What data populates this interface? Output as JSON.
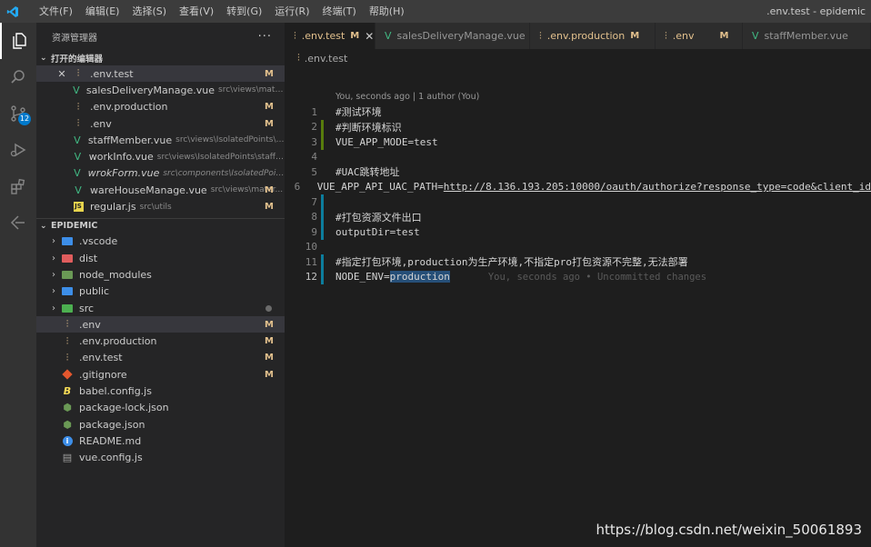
{
  "window": {
    "title": ".env.test - epidemic"
  },
  "menu": [
    "文件(F)",
    "编辑(E)",
    "选择(S)",
    "查看(V)",
    "转到(G)",
    "运行(R)",
    "终端(T)",
    "帮助(H)"
  ],
  "activity": {
    "scm_badge": "12"
  },
  "explorer": {
    "title": "资源管理器",
    "more": "···",
    "open_editors_title": "打开的编辑器",
    "open_editors": [
      {
        "icon": "env-file-icon",
        "name": ".env.test",
        "desc": "",
        "status": "M",
        "close": "✕"
      },
      {
        "icon": "vue-file-icon",
        "name": "salesDeliveryManage.vue",
        "desc": "src\\views\\materialM...",
        "status": ""
      },
      {
        "icon": "env-file-icon",
        "name": ".env.production",
        "desc": "",
        "status": "M"
      },
      {
        "icon": "env-file-icon",
        "name": ".env",
        "desc": "",
        "status": "M"
      },
      {
        "icon": "vue-file-icon",
        "name": "staffMember.vue",
        "desc": "src\\views\\IsolatedPoints\\staff...",
        "status": ""
      },
      {
        "icon": "vue-file-icon",
        "name": "workInfo.vue",
        "desc": "src\\views\\IsolatedPoints\\staffMe...",
        "status": ""
      },
      {
        "icon": "vue-file-icon",
        "name": "wrokForm.vue",
        "desc": "src\\components\\IsolatedPoints\\w...",
        "status": ""
      },
      {
        "icon": "vue-file-icon",
        "name": "wareHouseManage.vue",
        "desc": "src\\views\\mater...",
        "status": "M"
      },
      {
        "icon": "js-file-icon",
        "name": "regular.js",
        "desc": "src\\utils",
        "status": "M"
      }
    ],
    "project_title": "EPIDEMIC",
    "tree": [
      {
        "icon": "folder-vscode-icon",
        "name": ".vscode"
      },
      {
        "icon": "folder-dist-icon",
        "name": "dist"
      },
      {
        "icon": "folder-node-icon",
        "name": "node_modules"
      },
      {
        "icon": "folder-public-icon",
        "name": "public"
      },
      {
        "icon": "folder-src-icon",
        "name": "src"
      },
      {
        "icon": "env-file-icon",
        "name": ".env",
        "status": "M"
      },
      {
        "icon": "env-file-icon",
        "name": ".env.production",
        "status": "M"
      },
      {
        "icon": "env-file-icon",
        "name": ".env.test",
        "status": "M"
      },
      {
        "icon": "git-icon",
        "name": ".gitignore",
        "status": "M"
      },
      {
        "icon": "babel-icon",
        "name": "babel.config.js"
      },
      {
        "icon": "npm-icon",
        "name": "package-lock.json"
      },
      {
        "icon": "npm-icon",
        "name": "package.json"
      },
      {
        "icon": "info-icon",
        "name": "README.md"
      },
      {
        "icon": "vue-config-icon",
        "name": "vue.config.js"
      }
    ]
  },
  "tabs": [
    {
      "name": ".env.test",
      "status": "M",
      "close": "✕"
    },
    {
      "name": "salesDeliveryManage.vue",
      "status": ""
    },
    {
      "name": ".env.production",
      "status": "M"
    },
    {
      "name": ".env",
      "status": "M"
    },
    {
      "name": "staffMember.vue",
      "status": ""
    }
  ],
  "breadcrumb": ".env.test",
  "editor": {
    "codelens": "You, seconds ago | 1 author (You)",
    "lines": [
      {
        "n": "1",
        "text": "#测试环境"
      },
      {
        "n": "2",
        "text": "#判断环境标识"
      },
      {
        "n": "3",
        "text": "VUE_APP_MODE=test"
      },
      {
        "n": "4",
        "text": ""
      },
      {
        "n": "5",
        "text": "#UAC跳转地址"
      },
      {
        "n": "6",
        "text": "VUE_APP_API_UAC_PATH=",
        "url": "http://8.136.193.205:10000/oauth/authorize?response_type=code&client_id"
      },
      {
        "n": "7",
        "text": ""
      },
      {
        "n": "8",
        "text": "#打包资源文件出口"
      },
      {
        "n": "9",
        "text": "outputDir=test"
      },
      {
        "n": "10",
        "text": ""
      },
      {
        "n": "11",
        "text": "#指定打包环境,production为生产环境,不指定pro打包资源不完整,无法部署"
      },
      {
        "n": "12",
        "text": "NODE_ENV=",
        "hl": "production",
        "blame": "You, seconds ago • Uncommitted changes"
      }
    ]
  },
  "watermark": "https://blog.csdn.net/weixin_50061893",
  "colors": {
    "modified": "#e2c08d",
    "accent": "#007acc",
    "vue": "#41b883",
    "added_gutter": "#587c0c",
    "modified_gutter": "#0c7d9d"
  }
}
